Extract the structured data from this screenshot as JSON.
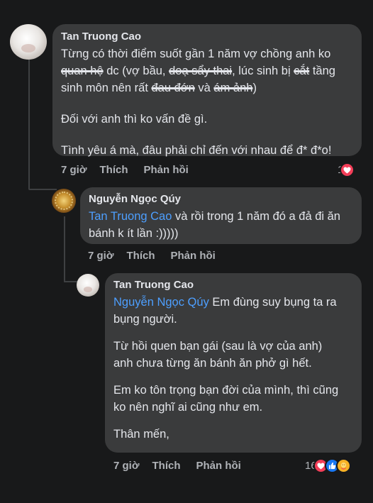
{
  "comments": [
    {
      "author": "Tan Truong Cao",
      "lines": [
        "Từng có thời điểm suốt gần 1 năm vợ chồng anh ko",
        "quan hệ",
        " dc (vợ bầu, ",
        "doạ sẩy thai",
        ", lúc sinh bị ",
        "cắt",
        " tầng",
        "sinh môn nên rất ",
        "đau đớn",
        " và ",
        "ám ảnh",
        ")",
        "Đối với anh thì ko vấn đề gì.",
        "Tình yêu á mà, đâu phải chỉ đến với nhau để đ* đ*o!"
      ],
      "time": "7 giờ",
      "like": "Thích",
      "reply": "Phản hồi",
      "reaction_count": "1",
      "reactions": [
        "heart-icon"
      ]
    },
    {
      "author": "Nguyễn Ngọc Qúy",
      "mention": "Tan Truong Cao",
      "line1": " và rồi trong 1 năm đó a đả đi ăn",
      "line2": "bánh k ít lần :)))))",
      "time": "7 giờ",
      "like": "Thích",
      "reply": "Phản hồi"
    },
    {
      "author": "Tan Truong Cao",
      "mention": "Nguyễn Ngọc Qúy",
      "line1": " Em đùng suy bụng ta ra",
      "line2": "bụng người.",
      "para2_l1": "Từ hồi quen bạn gái (sau là vợ của anh)",
      "para2_l2": "anh chưa từng ăn bánh ăn phở gì hết.",
      "para3_l1": "Em ko tôn trọng bạn đời của mình, thì cũng",
      "para3_l2": "ko nên nghĩ ai cũng như em.",
      "para4": "Thân mến,",
      "time": "7 giờ",
      "like": "Thích",
      "reply": "Phản hồi",
      "reaction_count": "16",
      "reactions": [
        "heart-icon",
        "like-icon",
        "care-icon"
      ]
    }
  ],
  "colors": {
    "background": "#18191a",
    "bubble": "#3a3b3c",
    "text": "#e4e6eb",
    "secondary": "#b0b3b8",
    "mention": "#4d9fff"
  }
}
